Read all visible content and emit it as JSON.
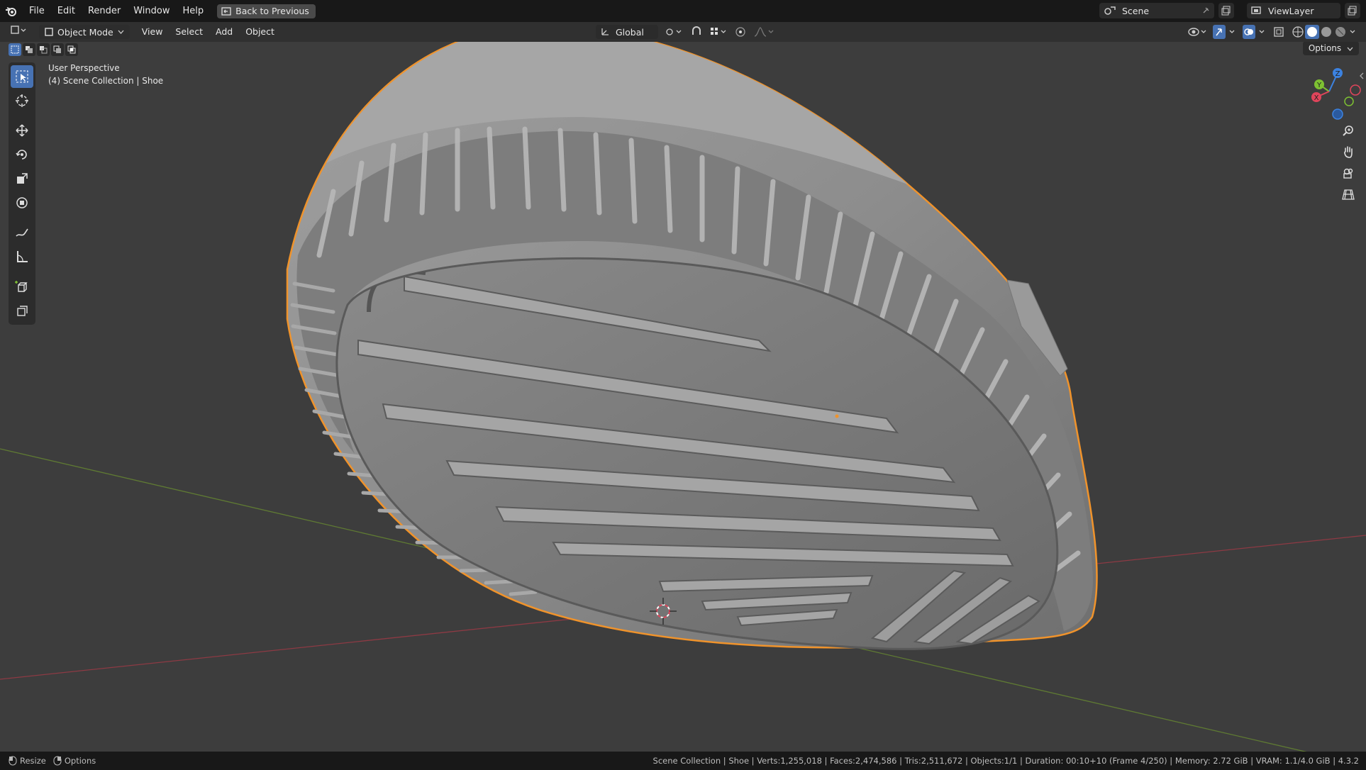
{
  "menu": {
    "items": [
      "File",
      "Edit",
      "Render",
      "Window",
      "Help"
    ],
    "back_button": "Back to Previous"
  },
  "scene": {
    "label": "Scene",
    "view_layer": "ViewLayer"
  },
  "header": {
    "mode": "Object Mode",
    "menus": [
      "View",
      "Select",
      "Add",
      "Object"
    ],
    "orientation": "Global",
    "options": "Options"
  },
  "viewport": {
    "perspective": "User Perspective",
    "collection": "(4) Scene Collection | Shoe",
    "gizmo_axes": [
      "X",
      "Y",
      "Z"
    ]
  },
  "status": {
    "left_items": [
      "Resize",
      "Options"
    ],
    "right": "Scene Collection | Shoe | Verts:1,255,018 | Faces:2,474,586 | Tris:2,511,672 | Objects:1/1 | Duration: 00:10+10 (Frame 4/250) | Memory: 2.72 GiB | VRAM: 1.1/4.0 GiB | 4.3.2"
  },
  "colors": {
    "accent": "#4772b3",
    "selection_outline": "#f0932b",
    "axis_x": "#e0455b",
    "axis_y": "#7ec132",
    "axis_z": "#3c82e0"
  }
}
